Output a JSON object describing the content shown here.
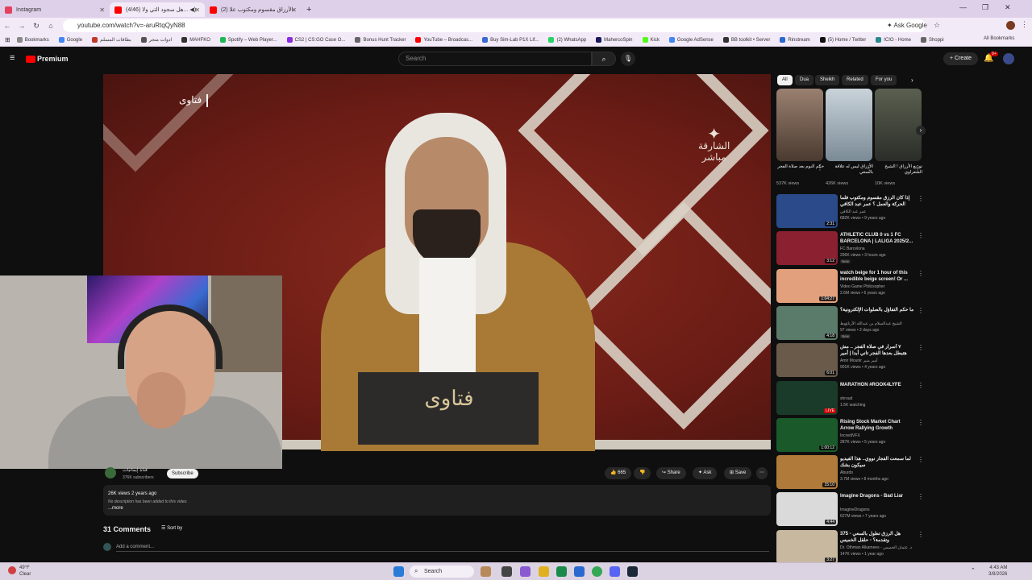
{
  "browser": {
    "tabs": [
      {
        "title": "Instagram",
        "color": "#e4405f"
      },
      {
        "title": "(4/46) هل سجود التي ولا... ◀)",
        "color": "#ff0000"
      },
      {
        "title": "(2) الأرزاق مقسوم ومكتوب علا...",
        "color": "#ff0000"
      }
    ],
    "url": "youtube.com/watch?v=-aruRtqQyN88",
    "ask_google": "Ask Google",
    "bookmarks": [
      "Bookmarks",
      "Google",
      "بطاقات المسلم",
      "ادوات متجر",
      "MAHFKO",
      "Spotify – Web Player...",
      "CS2 | CS:GO Case O...",
      "Bonus Hunt Tracker",
      "YouTube – Broadcas...",
      "Buy Sim-Lab P1X Lif...",
      "(2) WhatsApp",
      "MahercoSpin",
      "Kick",
      "Google AdSense",
      "BB toolkit • Server",
      "Rinstream",
      "(5) Home / Twitter",
      "ICIO - Home",
      "Shopping history"
    ],
    "all_bookmarks": "All Bookmarks"
  },
  "youtube": {
    "logo": "Premium",
    "search_placeholder": "Search",
    "create": "Create",
    "notif_count": "9+"
  },
  "video": {
    "overlay_title": "فتاوى",
    "channel_logo_line1": "الشارقة",
    "channel_logo_line2": "مباشر",
    "desk_text": "فتاوى"
  },
  "meta": {
    "channel": "قناة إيمانيات",
    "subscribers": "376K subscribers",
    "subscribe": "Subscribe",
    "likes": "665",
    "share": "Share",
    "ask": "Ask",
    "save": "Save",
    "views_line": "26K views  2 years ago",
    "description": "No description has been added to this video.",
    "more": "...more",
    "comments": "31 Comments",
    "sort_by": "Sort by",
    "add_comment": "Add a comment..."
  },
  "rail": {
    "chips": [
      "All",
      "Dua",
      "Sheikh",
      "Related",
      "For you"
    ],
    "shorts": [
      {
        "title": "حكم النوم بعد صلاة الفجر",
        "views": "537K views"
      },
      {
        "title": "الأرزاق ليس له علاقة بالسعي",
        "views": "426K views"
      },
      {
        "title": "توزيع الأرزاق ! الشيخ الشعراوي",
        "views": "10K views"
      }
    ],
    "recs": [
      {
        "title": "إذا كان الرزق مقسوم ومكتوب فلما الحركة والعمل ؟ عمر عبد الكافي",
        "channel": "عمر عبد الكافي",
        "meta": "682K views • 9 years ago",
        "dur": "2:31",
        "badge": ""
      },
      {
        "title": "ATHLETIC CLUB 0 vs 1 FC BARCELONA | LALIGA 2025/2...",
        "channel": "FC Barcelona",
        "meta": "296K views • 3 hours ago",
        "dur": "3:12",
        "badge": "New"
      },
      {
        "title": "watch beige for 1 hour of this incredible beige screen! Or ...",
        "channel": "Video Game Philosopher",
        "meta": "2.6M views • 6 years ago",
        "dur": "1:04:27",
        "badge": ""
      },
      {
        "title": "ما حكم التفاؤل بالصلوات الإلكترونية؟",
        "channel": "الشيخ عبدالسلام بن عبدالله الأرناؤوط",
        "meta": "97 views • 2 days ago",
        "dur": "4:18",
        "badge": "New"
      },
      {
        "title": "٧ أسرار في صلاة الفجر .. مش هتبطل بعدها الفجر تاني أبدا | أمير منير",
        "channel": "Amir Mounir أمير منير",
        "meta": "901K views • 4 years ago",
        "dur": "6:01",
        "badge": ""
      },
      {
        "title": "MARATHON #ROOK4LYFE",
        "channel": "shroud",
        "meta": "1.5K watching",
        "dur": "LIVE",
        "badge": ""
      },
      {
        "title": "Rising Stock Market Chart Arrow Rallying Growth Recove...",
        "channel": "IncrediVFX",
        "meta": "287K views • 5 years ago",
        "dur": "1:00:12",
        "badge": ""
      },
      {
        "title": "لما سمعت الفجار نووي.. هذا الفيديو سيكون بشك",
        "channel": "Aburdo",
        "meta": "3.7M views • 8 months ago",
        "dur": "15:10",
        "badge": ""
      },
      {
        "title": "Imagine Dragons - Bad Liar",
        "channel": "ImagineDragons",
        "meta": "627M views • 7 years ago",
        "dur": "4:44",
        "badge": ""
      },
      {
        "title": "375 - هل الرزق تطول بالسعي وتقدمة؟ - حلقل الخميس",
        "channel": "Dr. Othman Alkamees - د. عثمان الخميس",
        "meta": "147K views • 1 year ago",
        "dur": "3:27",
        "badge": ""
      }
    ]
  },
  "taskbar": {
    "temp": "49°F",
    "weather": "Clear",
    "search": "Search",
    "time": "4:43 AM",
    "date": "3/8/2026"
  }
}
